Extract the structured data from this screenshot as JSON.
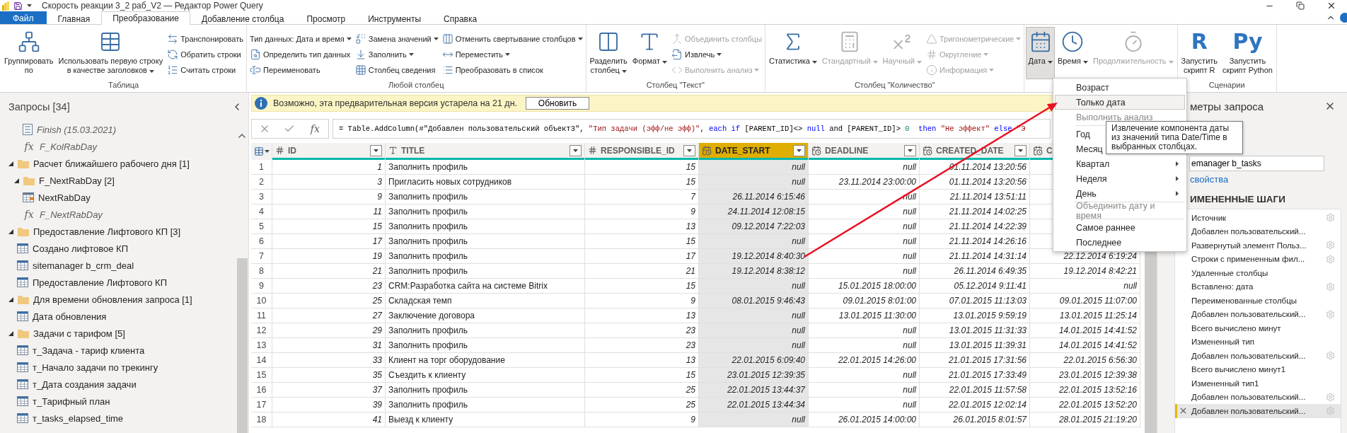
{
  "window": {
    "title": "Скорость реакции 3_2 раб_V2 — Редактор Power Query"
  },
  "tabs": [
    {
      "kind": "file",
      "label": "Файл",
      "selected": false
    },
    {
      "kind": "tab",
      "label": "Главная",
      "selected": false
    },
    {
      "kind": "tab",
      "label": "Преобразование",
      "selected": true
    },
    {
      "kind": "tab",
      "label": "Добавление столбца",
      "selected": false
    },
    {
      "kind": "tab",
      "label": "Просмотр",
      "selected": false
    },
    {
      "kind": "tab",
      "label": "Инструменты",
      "selected": false
    },
    {
      "kind": "tab",
      "label": "Справка",
      "selected": false
    }
  ],
  "ribbon": {
    "groups": [
      {
        "label": "Таблица",
        "items": [
          {
            "kind": "large",
            "label": "Группировать\nпо",
            "dropdown": false,
            "disabled": false,
            "pressed": false
          },
          {
            "kind": "large",
            "label": "Использовать первую строку\nв качестве заголовков",
            "dropdown": true,
            "disabled": false,
            "pressed": false
          },
          {
            "kind": "stack",
            "items": [
              {
                "label": "Транспонировать",
                "dropdown": false,
                "disabled": false
              },
              {
                "label": "Обратить строки",
                "dropdown": false,
                "disabled": false
              },
              {
                "label": "Считать строки",
                "dropdown": false,
                "disabled": false
              }
            ]
          }
        ]
      },
      {
        "label": "Любой столбец",
        "items": [
          {
            "kind": "stack",
            "items": [
              {
                "label": "Тип данных: Дата и время",
                "dropdown": true,
                "disabled": false
              },
              {
                "label": "Определить тип данных",
                "dropdown": false,
                "disabled": false
              },
              {
                "label": "Переименовать",
                "dropdown": false,
                "disabled": false
              }
            ]
          },
          {
            "kind": "stack",
            "items": [
              {
                "label": "Замена значений",
                "dropdown": true,
                "disabled": false
              },
              {
                "label": "Заполнить",
                "dropdown": true,
                "disabled": false
              },
              {
                "label": "Столбец сведения",
                "dropdown": false,
                "disabled": false
              }
            ]
          },
          {
            "kind": "stack",
            "items": [
              {
                "label": "Отменить свертывание столбцов",
                "dropdown": true,
                "disabled": false
              },
              {
                "label": "Переместить",
                "dropdown": true,
                "disabled": false
              },
              {
                "label": "Преобразовать в список",
                "dropdown": false,
                "disabled": false
              }
            ]
          }
        ]
      },
      {
        "label": "Столбец \"Текст\"",
        "items": [
          {
            "kind": "large",
            "label": "Разделить\nстолбец",
            "dropdown": true,
            "disabled": false,
            "pressed": false
          },
          {
            "kind": "large",
            "label": "Формат",
            "dropdown": true,
            "disabled": false,
            "pressed": false
          },
          {
            "kind": "stack",
            "items": [
              {
                "label": "Объединить столбцы",
                "dropdown": false,
                "disabled": true
              },
              {
                "label": "Извлечь",
                "dropdown": true,
                "disabled": false
              },
              {
                "label": "Выполнить анализ",
                "dropdown": true,
                "disabled": true
              }
            ]
          }
        ]
      },
      {
        "label": "Столбец \"Количество\"",
        "items": [
          {
            "kind": "large",
            "label": "Статистика",
            "dropdown": true,
            "disabled": false,
            "pressed": false
          },
          {
            "kind": "large",
            "label": "Стандартный",
            "dropdown": true,
            "disabled": true,
            "pressed": false
          },
          {
            "kind": "large",
            "label": "Научный",
            "dropdown": true,
            "disabled": true,
            "pressed": false
          },
          {
            "kind": "stack",
            "items": [
              {
                "label": "Тригонометрические",
                "dropdown": true,
                "disabled": true
              },
              {
                "label": "Округление",
                "dropdown": true,
                "disabled": true
              },
              {
                "label": "Информация",
                "dropdown": true,
                "disabled": true
              }
            ]
          }
        ]
      },
      {
        "items": [
          {
            "kind": "large",
            "label": "Дата",
            "dropdown": true,
            "disabled": false,
            "pressed": true
          },
          {
            "kind": "large",
            "label": "Время",
            "dropdown": true,
            "disabled": false,
            "pressed": false
          },
          {
            "kind": "large",
            "label": "Продолжительность",
            "dropdown": true,
            "disabled": true,
            "pressed": false
          }
        ]
      },
      {
        "label": "Сценарии",
        "items": [
          {
            "kind": "large",
            "glyph": "R",
            "label": "Запустить\nскрипт R",
            "dropdown": false,
            "disabled": false,
            "pressed": false
          },
          {
            "kind": "large",
            "glyph": "Py",
            "label": "Запустить\nскрипт Python",
            "dropdown": false,
            "disabled": false,
            "pressed": false
          }
        ]
      }
    ]
  },
  "queries": {
    "title": "Запросы [34]",
    "items": [
      {
        "kind": "continued",
        "children": [
          {
            "kind": "continued",
            "children": [
              {
                "kind": "list",
                "label": "Finish (15.03.2021)",
                "loaded": false
              },
              {
                "kind": "function",
                "glyph": "fx",
                "label": "F_KolRabDay",
                "loaded": false
              }
            ]
          }
        ]
      },
      {
        "kind": "folder",
        "label": "Расчет ближайшего рабочего дня [1]",
        "expanded": true,
        "children": [
          {
            "kind": "folder",
            "label": "F_NextRabDay [2]",
            "expanded": true,
            "children": [
              {
                "kind": "date-table",
                "label": "NextRabDay",
                "loaded": true
              },
              {
                "kind": "function",
                "glyph": "fx",
                "label": "F_NextRabDay",
                "loaded": false
              }
            ]
          }
        ]
      },
      {
        "kind": "folder",
        "label": "Предоставление Лифтового КП [3]",
        "expanded": true,
        "children": [
          {
            "kind": "table",
            "label": "Создано лифтовое КП",
            "loaded": true
          },
          {
            "kind": "table",
            "label": "sitemanager b_crm_deal",
            "loaded": true
          },
          {
            "kind": "table",
            "label": "Предоставление Лифтового КП",
            "loaded": true
          }
        ]
      },
      {
        "kind": "folder",
        "label": "Для времени обновления запроса [1]",
        "expanded": true,
        "children": [
          {
            "kind": "table",
            "label": "Дата обновления",
            "loaded": true
          }
        ]
      },
      {
        "kind": "folder",
        "label": "Задачи с тарифом [5]",
        "expanded": true,
        "children": [
          {
            "kind": "table",
            "label": "т_Задача - тариф клиента",
            "loaded": true
          },
          {
            "kind": "table",
            "label": "т_Начало задачи по трекингу",
            "loaded": true
          },
          {
            "kind": "table",
            "label": "т_Дата создания задачи",
            "loaded": true
          },
          {
            "kind": "table",
            "label": "т_Тарифный план",
            "loaded": true
          },
          {
            "kind": "table",
            "label": "т_tasks_elapsed_time",
            "loaded": true
          }
        ]
      }
    ]
  },
  "info_bar": {
    "message": "Возможно, эта предварительная версия устарела на 21 дн.",
    "button": "Обновить"
  },
  "formula": {
    "fx_glyph": "fx",
    "tokens": [
      {
        "kind": "text",
        "text": "= Table.AddColumn(#\"Добавлен пользовательский объект3\", "
      },
      {
        "kind": "string",
        "text": "\"Тип задачи (эфф/не эфф)\""
      },
      {
        "kind": "text",
        "text": ", "
      },
      {
        "kind": "keyword",
        "text": "each if"
      },
      {
        "kind": "text",
        "text": " [PARENT_ID]<> "
      },
      {
        "kind": "keyword",
        "text": "null"
      },
      {
        "kind": "text",
        "text": " and [PARENT_ID]> "
      },
      {
        "kind": "number",
        "text": "0"
      },
      {
        "kind": "keyword",
        "text": "  then"
      },
      {
        "kind": "string",
        "text": " \"Не эффект\""
      },
      {
        "kind": "keyword",
        "text": " else"
      },
      {
        "kind": "string",
        "text": " \"Э"
      }
    ]
  },
  "table": {
    "columns": [
      {
        "name": "ID",
        "kind": "number",
        "selected": false
      },
      {
        "name": "TITLE",
        "kind": "text",
        "selected": false
      },
      {
        "name": "RESPONSIBLE_ID",
        "kind": "number",
        "selected": false
      },
      {
        "name": "DATE_START",
        "kind": "datetime",
        "selected": true
      },
      {
        "name": "DEADLINE",
        "kind": "datetime",
        "selected": false
      },
      {
        "name": "CREATED_DATE",
        "kind": "datetime",
        "selected": false
      },
      {
        "name": "C",
        "kind": "datetime",
        "selected": false
      }
    ],
    "rows": [
      {
        "number": "1",
        "cells": [
          "1",
          "Заполнить профиль",
          "15",
          "null",
          "null",
          "01.11.2014 13:20:56"
        ]
      },
      {
        "number": "2",
        "cells": [
          "3",
          "Пригласить новых сотрудников",
          "15",
          "null",
          "23.11.2014 23:00:00",
          "01.11.2014 13:20:56"
        ]
      },
      {
        "number": "3",
        "cells": [
          "9",
          "Заполнить профиль",
          "7",
          "26.11.2014 6:15:46",
          "null",
          "21.11.2014 13:51:11"
        ]
      },
      {
        "number": "4",
        "cells": [
          "11",
          "Заполнить профиль",
          "9",
          "24.11.2014 12:08:15",
          "null",
          "21.11.2014 14:02:25"
        ]
      },
      {
        "number": "5",
        "cells": [
          "15",
          "Заполнить профиль",
          "13",
          "09.12.2014 7:22:03",
          "null",
          "21.11.2014 14:22:39"
        ]
      },
      {
        "number": "6",
        "cells": [
          "17",
          "Заполнить профиль",
          "15",
          "null",
          "null",
          "21.11.2014 14:26:16"
        ]
      },
      {
        "number": "7",
        "cells": [
          "19",
          "Заполнить профиль",
          "17",
          "19.12.2014 8:40:30",
          "null",
          "21.11.2014 14:31:14",
          "22.12.2014 6:19:24"
        ]
      },
      {
        "number": "8",
        "cells": [
          "21",
          "Заполнить профиль",
          "21",
          "19.12.2014 8:38:12",
          "null",
          "26.11.2014 6:49:35",
          "19.12.2014 8:42:21"
        ]
      },
      {
        "number": "9",
        "cells": [
          "23",
          "CRM:Разработка сайта на системе Bitrix",
          "15",
          "null",
          "15.01.2015 18:00:00",
          "05.12.2014 9:11:41",
          "null"
        ]
      },
      {
        "number": "10",
        "cells": [
          "25",
          "Складская темп",
          "9",
          "08.01.2015 9:46:43",
          "09.01.2015 8:01:00",
          "07.01.2015 11:13:03",
          "09.01.2015 11:07:00"
        ]
      },
      {
        "number": "11",
        "cells": [
          "27",
          "Заключение договора",
          "13",
          "null",
          "13.01.2015 11:30:00",
          "13.01.2015 9:59:19",
          "13.01.2015 11:25:14"
        ]
      },
      {
        "number": "12",
        "cells": [
          "29",
          "Заполнить профиль",
          "23",
          "null",
          "null",
          "13.01.2015 11:31:33",
          "14.01.2015 14:41:52"
        ]
      },
      {
        "number": "13",
        "cells": [
          "31",
          "Заполнить профиль",
          "23",
          "null",
          "null",
          "13.01.2015 11:39:31",
          "14.01.2015 14:41:52"
        ]
      },
      {
        "number": "14",
        "cells": [
          "33",
          "Клиент на торг оборудование",
          "13",
          "22.01.2015 6:09:40",
          "22.01.2015 14:26:00",
          "21.01.2015 17:31:56",
          "22.01.2015 6:56:30"
        ]
      },
      {
        "number": "15",
        "cells": [
          "35",
          "Съездить к клиенту",
          "15",
          "23.01.2015 12:39:35",
          "null",
          "21.01.2015 17:33:49",
          "23.01.2015 12:39:38"
        ]
      },
      {
        "number": "16",
        "cells": [
          "37",
          "Заполнить профиль",
          "25",
          "22.01.2015 13:44:37",
          "null",
          "22.01.2015 11:57:58",
          "22.01.2015 13:52:16"
        ]
      },
      {
        "number": "17",
        "cells": [
          "39",
          "Заполнить профиль",
          "25",
          "22.01.2015 13:44:34",
          "null",
          "22.01.2015 12:02:14",
          "22.01.2015 13:52:20"
        ]
      },
      {
        "number": "18",
        "cells": [
          "41",
          "Выезд к клиенту",
          "9",
          "null",
          "26.01.2015 14:00:00",
          "26.01.2015 8:01:57",
          "28.01.2015 21:19:20"
        ]
      }
    ]
  },
  "query_settings": {
    "title": "метры запроса",
    "name_field": {
      "value": "emanager b_tasks"
    },
    "properties_link": "свойства",
    "steps_heading": "ИМЕНЕННЫЕ ШАГИ",
    "steps": [
      {
        "label": "Источник",
        "has_settings": true,
        "selected": false
      },
      {
        "label": "Добавлен пользовательский...",
        "has_settings": false,
        "selected": false
      },
      {
        "label": "Развернутый элемент Польз...",
        "has_settings": true,
        "selected": false
      },
      {
        "label": "Строки с примененным фил...",
        "has_settings": true,
        "selected": false
      },
      {
        "label": "Удаленные столбцы",
        "has_settings": false,
        "selected": false
      },
      {
        "label": "Вставлено: дата",
        "has_settings": true,
        "selected": false
      },
      {
        "label": "Переименованные столбцы",
        "has_settings": false,
        "selected": false
      },
      {
        "label": "Добавлен пользовательский...",
        "has_settings": true,
        "selected": false
      },
      {
        "label": "Всего вычислено минут",
        "has_settings": false,
        "selected": false
      },
      {
        "label": "Измененный тип",
        "has_settings": false,
        "selected": false
      },
      {
        "label": "Добавлен пользовательский...",
        "has_settings": true,
        "selected": false
      },
      {
        "label": "Всего вычислено минут1",
        "has_settings": false,
        "selected": false
      },
      {
        "label": "Измененный тип1",
        "has_settings": false,
        "selected": false
      },
      {
        "label": "Добавлен пользовательский...",
        "has_settings": true,
        "selected": false
      },
      {
        "label": "Добавлен пользовательский...",
        "has_settings": true,
        "selected": true
      }
    ]
  },
  "context_menu": {
    "items": [
      {
        "kind": "item",
        "label": "Возраст",
        "disabled": false,
        "highlighted": false
      },
      {
        "kind": "item",
        "label": "Только дата",
        "disabled": false,
        "highlighted": true
      },
      {
        "kind": "item",
        "label": "Выполнить анализ",
        "disabled": true,
        "highlighted": false
      },
      {
        "kind": "separator"
      },
      {
        "kind": "item",
        "label": "Год",
        "disabled": false,
        "highlighted": false
      },
      {
        "kind": "item",
        "label": "Месяц",
        "disabled": false,
        "highlighted": false
      },
      {
        "kind": "submenu",
        "label": "Квартал",
        "disabled": false,
        "highlighted": false
      },
      {
        "kind": "submenu",
        "label": "Неделя",
        "disabled": false,
        "highlighted": false
      },
      {
        "kind": "submenu",
        "label": "День",
        "disabled": false,
        "highlighted": false
      },
      {
        "kind": "separator"
      },
      {
        "kind": "item",
        "label": "Объединить дату и время",
        "disabled": true,
        "highlighted": false
      },
      {
        "kind": "separator"
      },
      {
        "kind": "item",
        "label": "Самое раннее",
        "disabled": false,
        "highlighted": false
      },
      {
        "kind": "item",
        "label": "Последнее",
        "disabled": false,
        "highlighted": false
      }
    ]
  },
  "tooltip": {
    "text": "Извлечение компонента даты из значений типа Date/Time в выбранных столбцах."
  }
}
